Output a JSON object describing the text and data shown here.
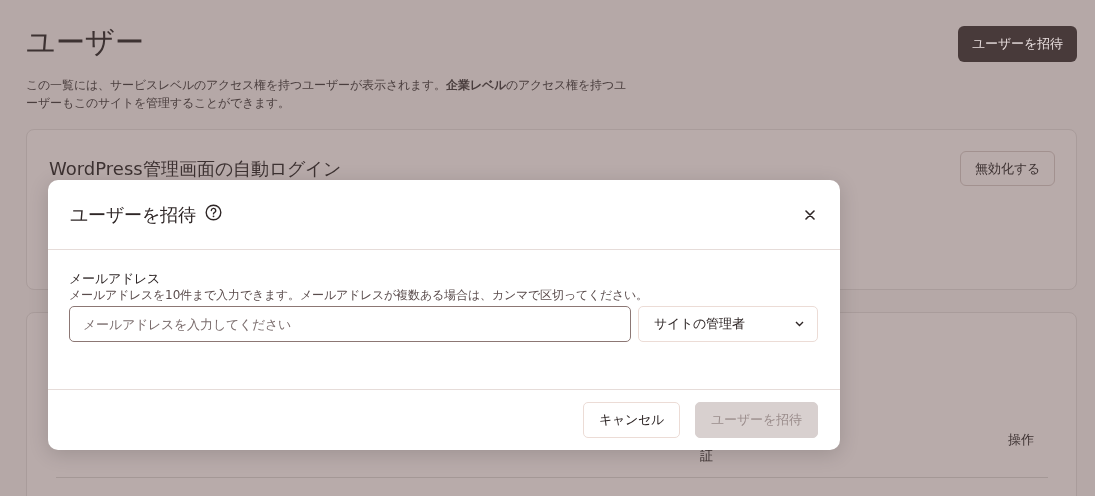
{
  "page": {
    "title": "ユーザー",
    "description": "この一覧には、サービスレベルのアクセス権を持つユーザーが表示されます。**企業レベル**のアクセス権を持つユーザーもこのサイトを管理することができます。",
    "invite_button": "ユーザーを招待"
  },
  "autologin_card": {
    "title": "WordPress管理画面の自動ログイン",
    "button": "無効化する"
  },
  "users_table": {
    "columns": [
      {
        "label": "証"
      },
      {
        "label": "操作"
      }
    ]
  },
  "dialog": {
    "title": "ユーザーを招待",
    "email": {
      "label": "メールアドレス",
      "hint": "メールアドレスを10件まで入力できます。メールアドレスが複数ある場合は、カンマで区切ってください。",
      "placeholder": "メールアドレスを入力してください"
    },
    "role": {
      "value": "サイトの管理者"
    },
    "buttons": [
      {
        "label": "キャンセル",
        "disabled": false
      },
      {
        "label": "ユーザーを招待",
        "disabled": true
      }
    ]
  }
}
